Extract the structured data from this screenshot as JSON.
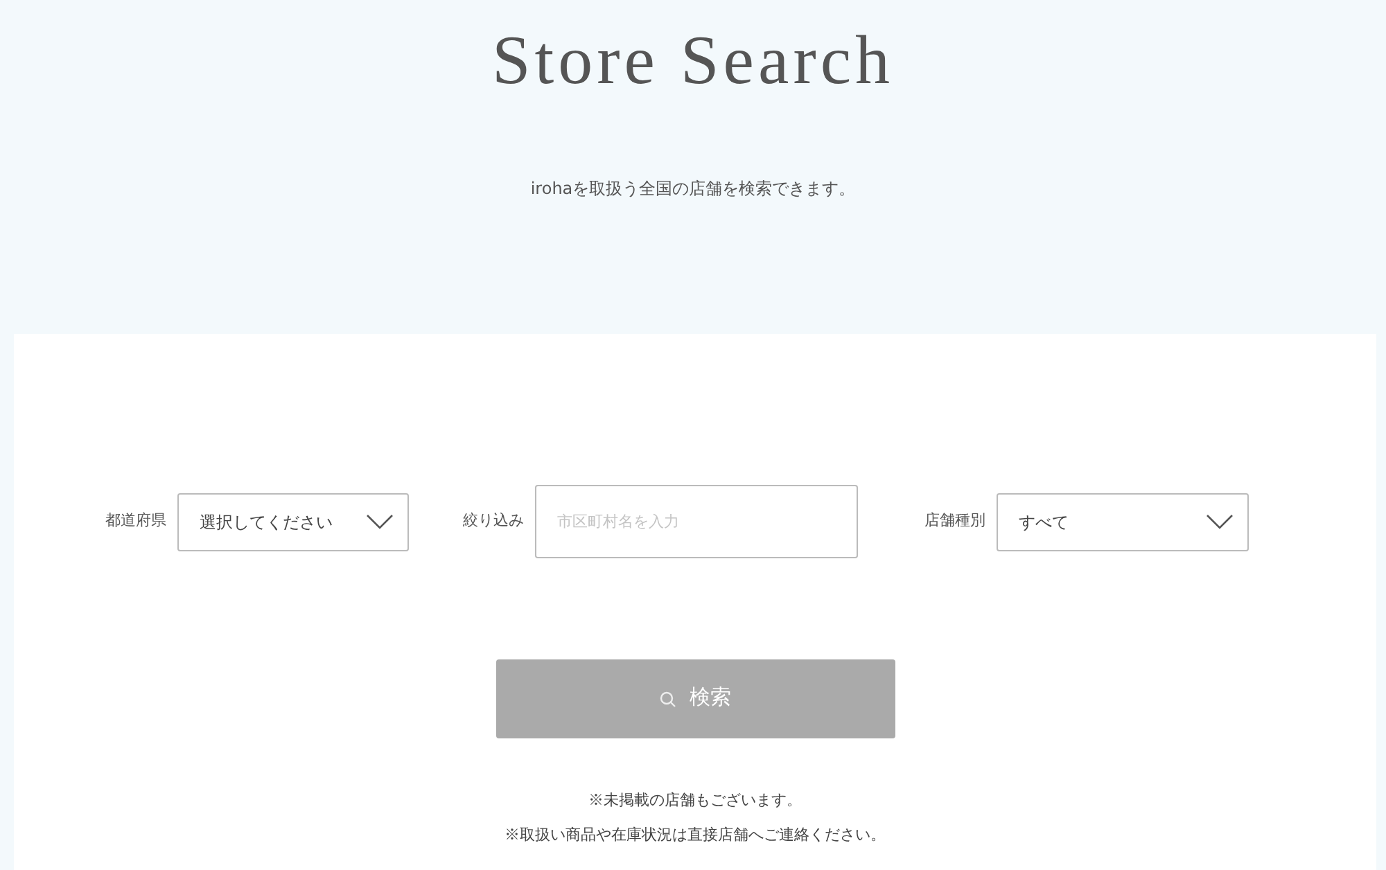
{
  "header": {
    "title": "Store Search",
    "subtitle": "irohaを取扱う全国の店舗を検索できます。"
  },
  "filters": [
    {
      "kind": "select",
      "label": "都道府県",
      "value": "選択してください"
    },
    {
      "kind": "text",
      "label": "絞り込み",
      "placeholder": "市区町村名を入力"
    },
    {
      "kind": "select",
      "label": "店舗種別",
      "value": "すべて"
    }
  ],
  "search_button": {
    "label": "検索"
  },
  "notes": [
    "※未掲載の店舗もございます。",
    "※取扱い商品や在庫状況は直接店舗へご連絡ください。"
  ]
}
